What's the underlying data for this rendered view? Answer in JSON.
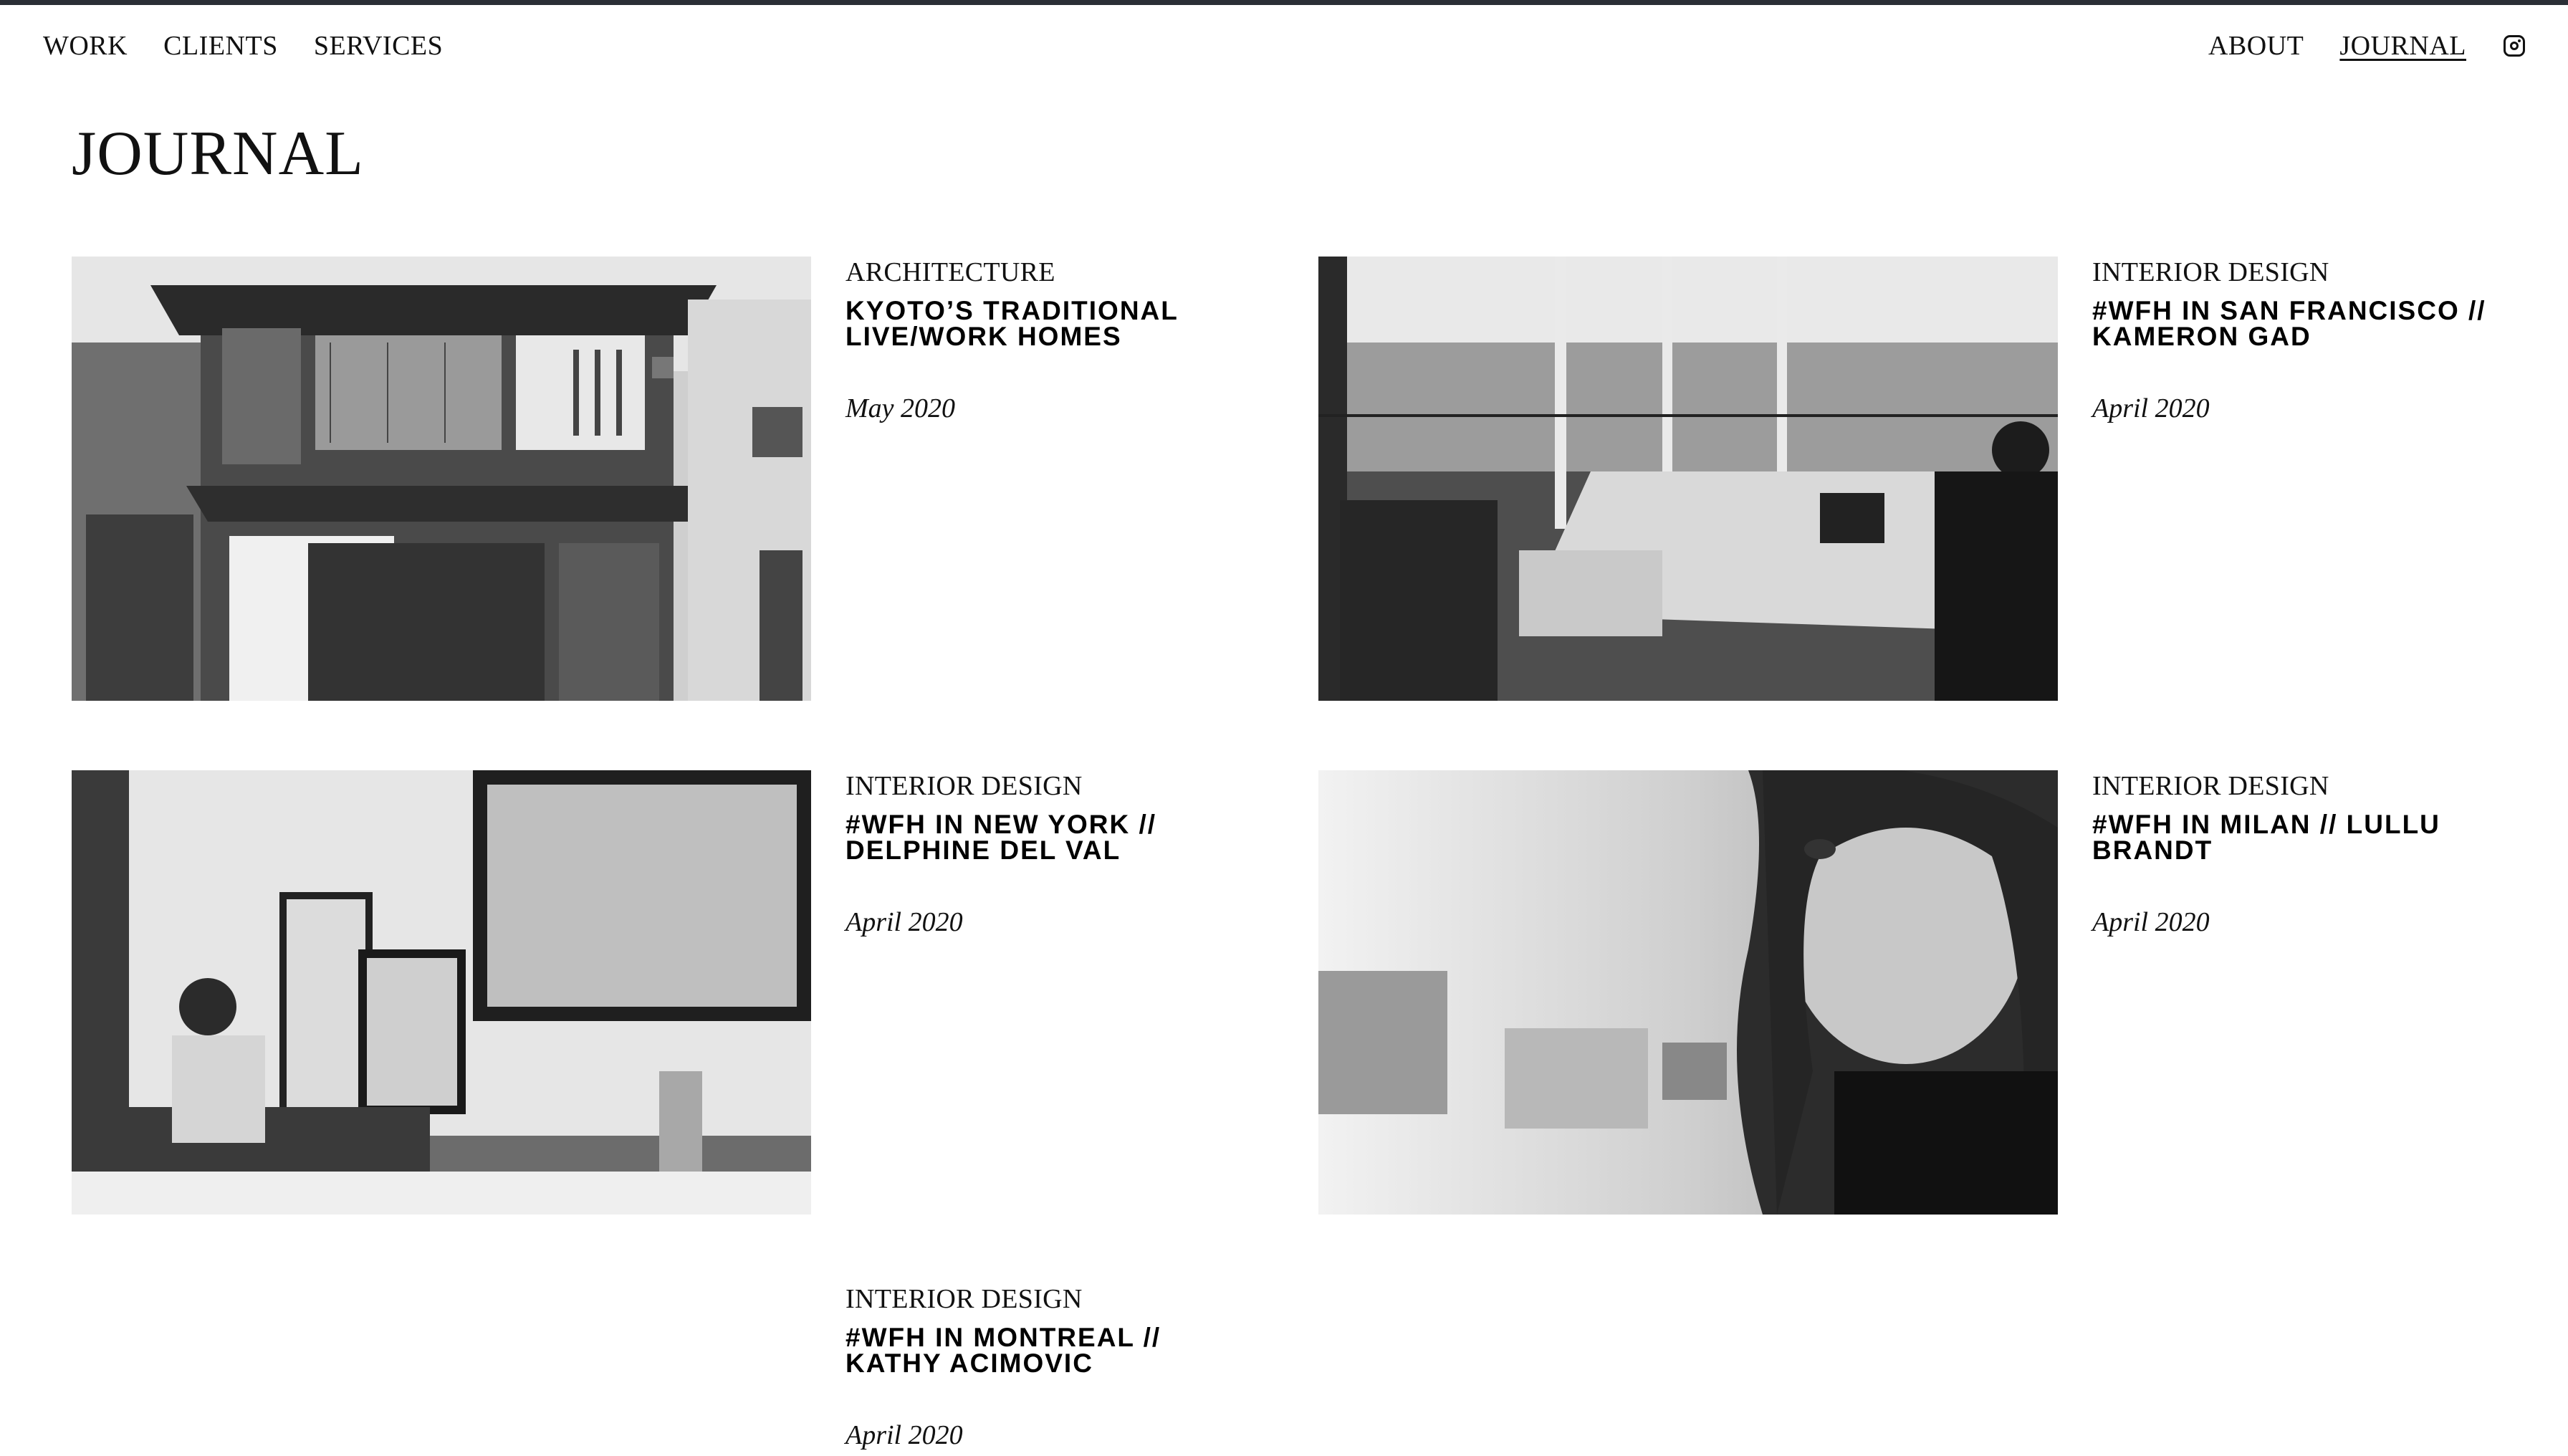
{
  "nav": {
    "left": [
      "WORK",
      "CLIENTS",
      "SERVICES"
    ],
    "right": [
      "ABOUT",
      "JOURNAL"
    ],
    "active": "JOURNAL"
  },
  "page": {
    "title": "JOURNAL"
  },
  "posts": [
    {
      "category": "ARCHITECTURE",
      "title": "KYOTO’S TRADITIONAL LIVE/WORK HOMES",
      "date": "May 2020"
    },
    {
      "category": "INTERIOR DESIGN",
      "title": "#WFH IN SAN FRANCISCO // KAMERON GAD",
      "date": "April 2020"
    },
    {
      "category": "INTERIOR DESIGN",
      "title": "#WFH IN NEW YORK // DELPHINE DEL VAL",
      "date": "April 2020"
    },
    {
      "category": "INTERIOR DESIGN",
      "title": "#WFH IN MILAN // LULLU BRANDT",
      "date": "April 2020"
    },
    {
      "category": "INTERIOR DESIGN",
      "title": "#WFH IN MONTREAL // KATHY ACIMOVIC",
      "date": "April 2020"
    }
  ],
  "icons": {
    "social": "instagram-icon"
  },
  "colors": {
    "topbar": "#2b2f36",
    "text": "#111111",
    "background": "#ffffff"
  }
}
